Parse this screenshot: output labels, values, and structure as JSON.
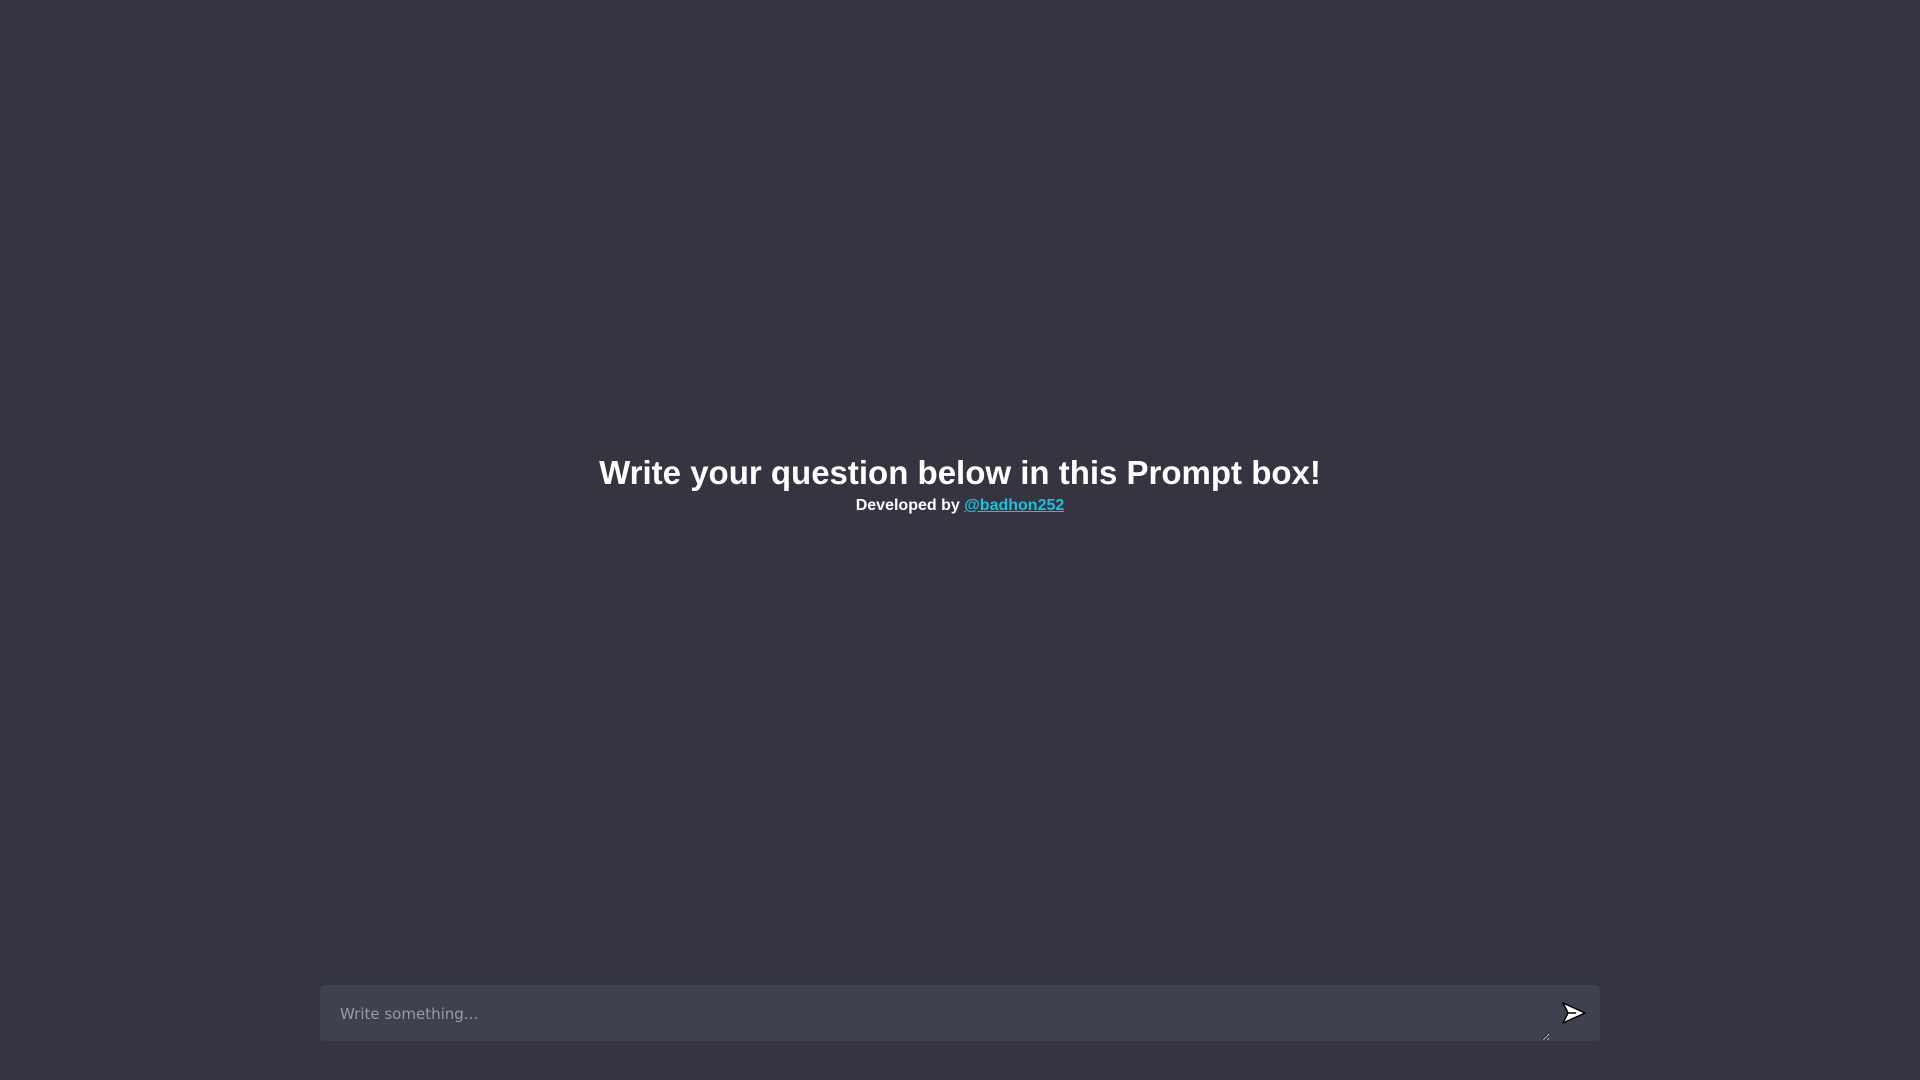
{
  "welcome": {
    "title": "Write your question below in this Prompt box!",
    "credit_prefix": "Developed by ",
    "credit_handle": "@badhon252"
  },
  "prompt": {
    "placeholder": "Write something...",
    "value": "",
    "send_icon": "send-icon"
  },
  "colors": {
    "background": "#343541",
    "input_background": "#40414f",
    "link": "#19c3e0",
    "text": "#ffffff"
  }
}
